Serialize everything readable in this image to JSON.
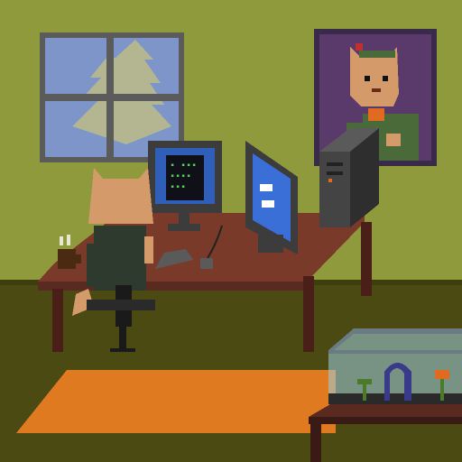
{
  "scene": {
    "colors": {
      "wall": "#8e9a3c",
      "floor": "#4a4a12",
      "baseboard": "#3d3d0e",
      "window_frame": "#5b5b5b",
      "sky": "#7d95c9",
      "tree": "#b9b98a",
      "desk_top": "#7a3a2a",
      "desk_dark": "#4a1f18",
      "rug": "#e07a20",
      "monitor": "#3c3c3c",
      "screen_blue": "#3a6fd8",
      "cat_fur": "#d49a6a",
      "shirt": "#2d3a2d",
      "portrait_bg": "#5a3a6a",
      "portrait_shirt": "#4a6a3a",
      "tank_glass": "#9fd0e0",
      "tank_table": "#3a1a14",
      "arch": "#3a3a8a",
      "flower": "#e06a20"
    },
    "monitor1": {
      "screen_text_lines": [
        "▪ ▪▪▪",
        "▪▪▪▪",
        "▪▪▪"
      ]
    },
    "icons": [
      "window",
      "monitor",
      "monitor",
      "pc-tower",
      "portrait",
      "cat",
      "chair",
      "mug",
      "keyboard",
      "mouse",
      "rug",
      "fish-tank",
      "plant"
    ]
  }
}
